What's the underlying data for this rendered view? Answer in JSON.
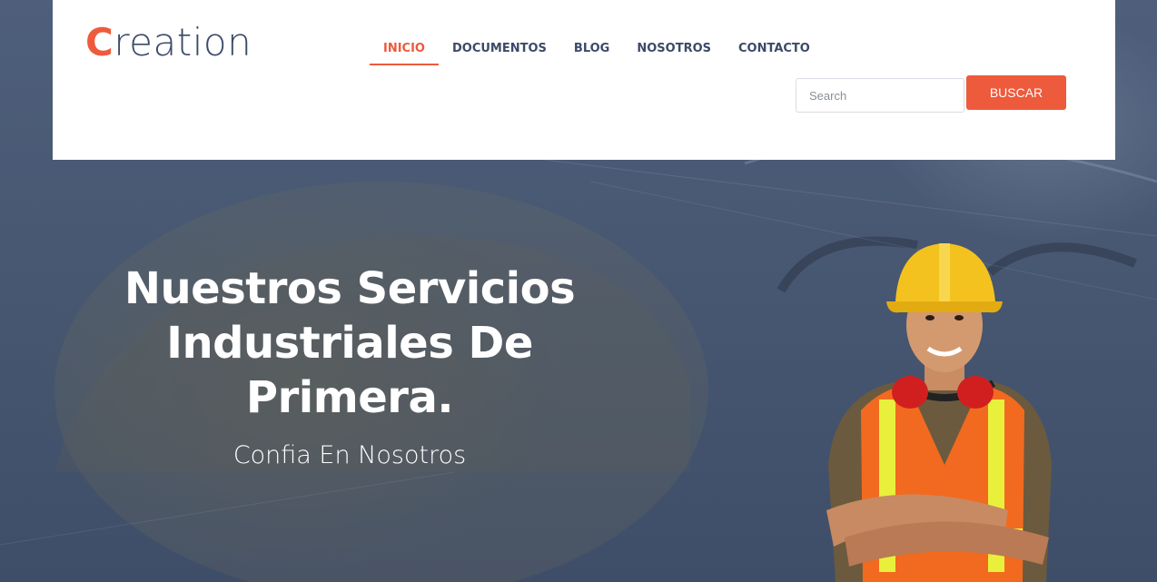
{
  "brand": {
    "logo_first": "C",
    "logo_rest": "reation"
  },
  "nav": {
    "items": [
      {
        "label": "INICIO",
        "active": true
      },
      {
        "label": "DOCUMENTOS",
        "active": false
      },
      {
        "label": "BLOG",
        "active": false
      },
      {
        "label": "NOSOTROS",
        "active": false
      },
      {
        "label": "CONTACTO",
        "active": false
      }
    ]
  },
  "search": {
    "placeholder": "Search",
    "value": "",
    "button_label": "BUSCAR"
  },
  "hero": {
    "title": "Nuestros Servicios Industriales De Primera.",
    "subtitle": "Confia En Nosotros"
  },
  "colors": {
    "accent": "#ee5a3c",
    "nav_text": "#3c4a68",
    "hero_overlay": "#4a5b76",
    "header_bg": "#ffffff"
  },
  "images": {
    "hero_background": "construction-blueprint-helmet-photo",
    "worker": "construction-worker-hardhat-vest-photo"
  }
}
